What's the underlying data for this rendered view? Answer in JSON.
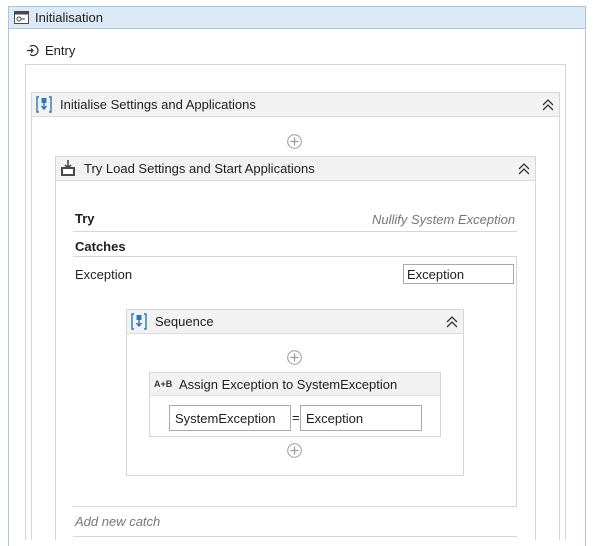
{
  "state": {
    "title": "Initialisation",
    "icon": "state-icon"
  },
  "entry": {
    "label": "Entry",
    "icon": "entry-icon"
  },
  "sequence": {
    "title": "Initialise Settings and Applications",
    "icon": "sequence-icon"
  },
  "try_catch": {
    "title": "Try Load Settings and Start Applications",
    "icon": "try-catch-icon",
    "try_label": "Try",
    "try_body": "Nullify System Exception",
    "catches_label": "Catches",
    "catch": {
      "exception_type": "Exception",
      "variable_value": "Exception",
      "sequence": {
        "title": "Sequence",
        "assign": {
          "badge": "A+B",
          "title": "Assign Exception to SystemException",
          "to_value": "SystemException",
          "operator": "=",
          "value": "Exception"
        }
      }
    },
    "add_catch_label": "Add new catch"
  }
}
